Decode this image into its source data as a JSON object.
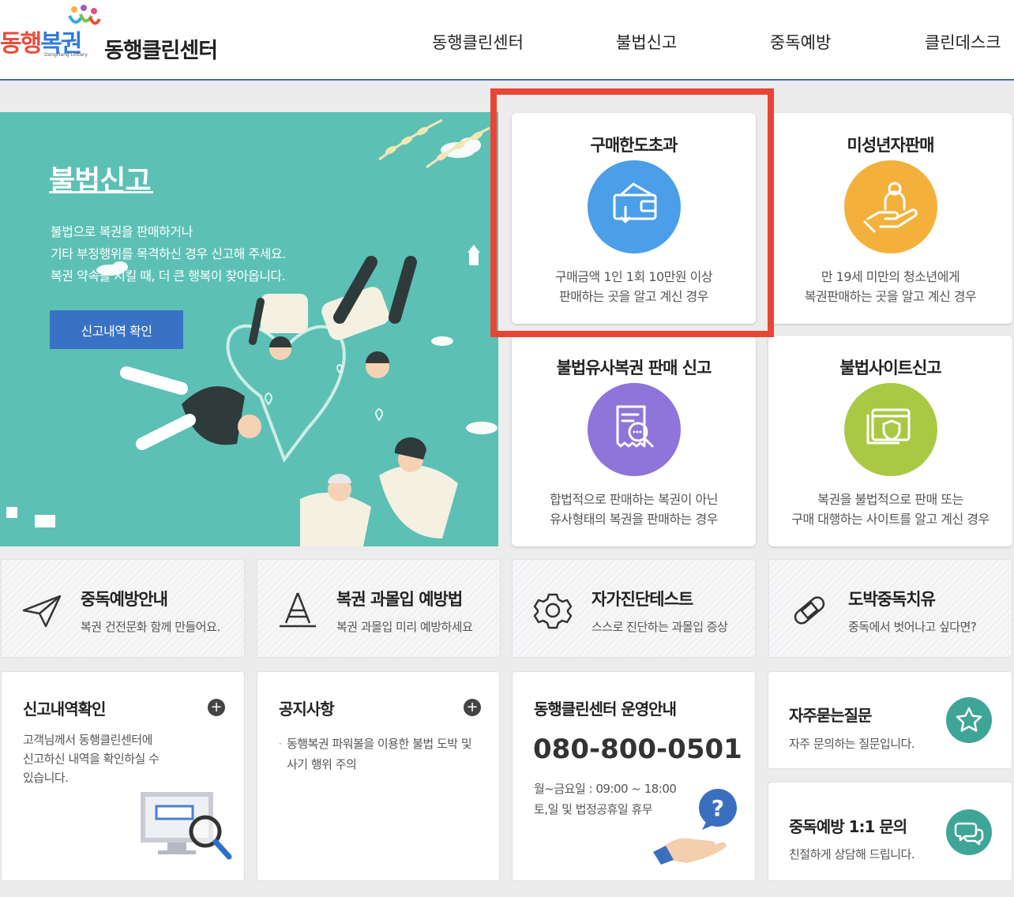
{
  "header": {
    "logo_text_a": "동행",
    "logo_text_b": "복권",
    "logo_sub": "DongHang Lottery",
    "site_name": "동행클린센터",
    "nav": [
      "동행클린센터",
      "불법신고",
      "중독예방",
      "클린데스크"
    ]
  },
  "hero": {
    "title": "불법신고",
    "description_lines": [
      "불법으로 복권을 판매하거나",
      "기타 부정행위를 목격하신 경우 신고해 주세요.",
      "복권 약속을 지킬 때, 더 큰 행복이 찾아옵니다."
    ],
    "button_label": "신고내역 확인"
  },
  "categories": [
    {
      "title": "구매한도초과",
      "icon": "wallet-down-icon",
      "color": "#4a9fe8",
      "desc_lines": [
        "구매금액 1인 1회 10만원 이상",
        "판매하는 곳을 알고 계신 경우"
      ]
    },
    {
      "title": "미성년자판매",
      "icon": "hand-person-icon",
      "color": "#f3b13c",
      "desc_lines": [
        "만 19세 미만의 청소년에게",
        "복권판매하는 곳을 알고 계신 경우"
      ]
    },
    {
      "title": "불법유사복권 판매 신고",
      "icon": "receipt-search-icon",
      "color": "#8f74d9",
      "desc_lines": [
        "합법적으로 판매하는 복권이 아닌",
        "유사형태의 복권을 판매하는 경우"
      ]
    },
    {
      "title": "불법사이트신고",
      "icon": "browser-shield-icon",
      "color": "#a9c945",
      "desc_lines": [
        "복권을 불법적으로 판매 또는",
        "구매 대행하는 사이트를 알고 계신 경우"
      ]
    }
  ],
  "quick_links": [
    {
      "title": "중독예방안내",
      "sub": "복권 건전문화 함께 만들어요.",
      "icon": "paper-plane-icon"
    },
    {
      "title": "복권 과몰입 예방법",
      "sub": "복권 과몰입 미리 예방하세요",
      "icon": "cone-icon"
    },
    {
      "title": "자가진단테스트",
      "sub": "스스로 진단하는 과몰입 증상",
      "icon": "gear-icon"
    },
    {
      "title": "도박중독치유",
      "sub": "중독에서 벗어나고 싶다면?",
      "icon": "bandage-icon"
    }
  ],
  "report_panel": {
    "title": "신고내역확인",
    "text_lines": [
      "고객님께서 동행클린센터에",
      "신고하신 내역을 확인하실 수",
      "있습니다."
    ],
    "plus": "+"
  },
  "notice_panel": {
    "title": "공지사항",
    "items": [
      "동행복권 파워볼을 이용한 불법 도박 및 사기 행위 주의"
    ],
    "plus": "+"
  },
  "operation_panel": {
    "title": "동행클린센터 운영안내",
    "phone": "080-800-0501",
    "hours_lines": [
      "월~금요일 : 09:00 ~ 18:00",
      "토,일 및 법정공휴일 휴무"
    ]
  },
  "faq": {
    "title": "자주묻는질문",
    "sub": "자주 문의하는 질문입니다."
  },
  "inquiry": {
    "title": "중독예방 1:1 문의",
    "sub": "친절하게 상담해 드립니다."
  }
}
